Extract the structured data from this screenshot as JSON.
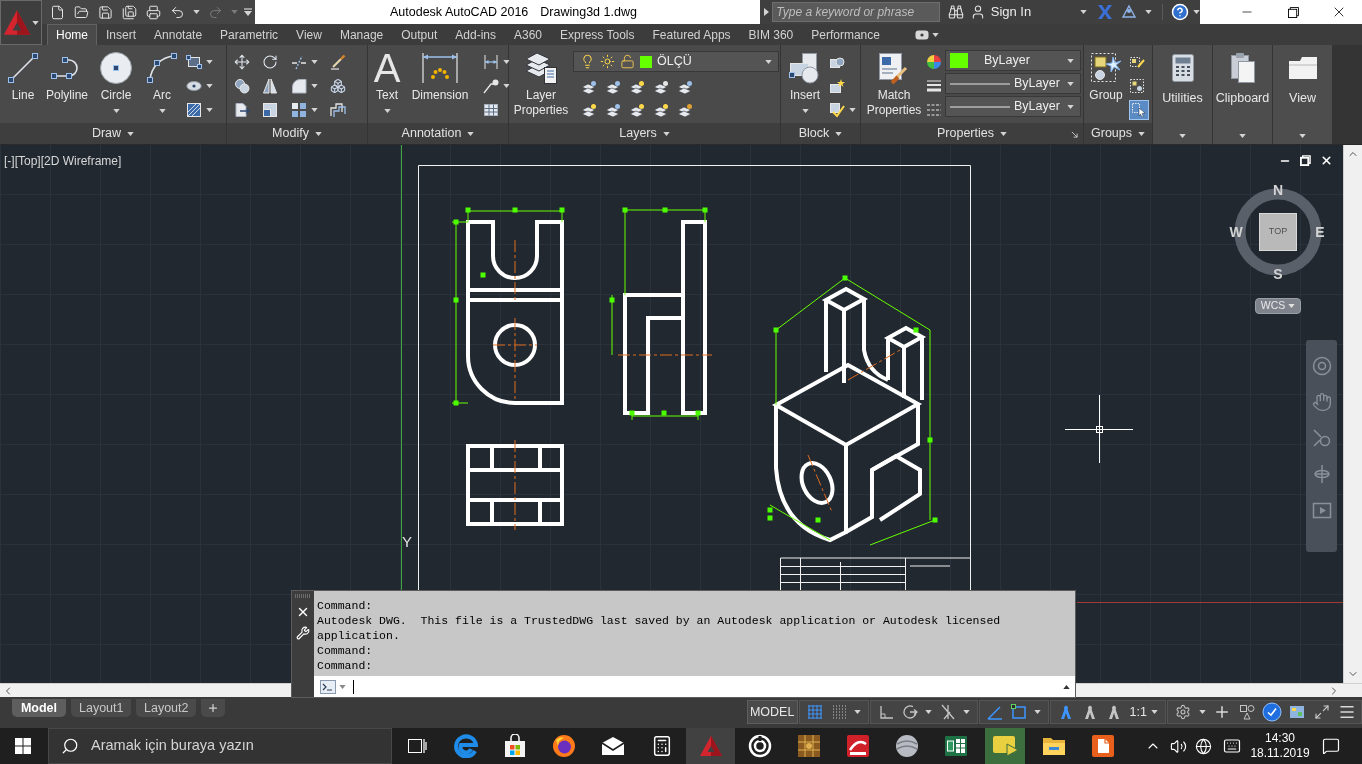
{
  "quick_access": [
    {
      "kind": "new",
      "disabled": false
    },
    {
      "kind": "open",
      "disabled": false
    },
    {
      "kind": "save",
      "disabled": false
    },
    {
      "kind": "save-as",
      "disabled": false
    },
    {
      "kind": "plot",
      "disabled": false
    },
    {
      "kind": "undo",
      "disabled": false
    },
    {
      "kind": "redo",
      "disabled": true
    }
  ],
  "title_bar": {
    "app_name": "Autodesk AutoCAD 2016",
    "document": "Drawing3d 1.dwg"
  },
  "search": {
    "placeholder": "Type a keyword or phrase"
  },
  "account": {
    "label": "Sign In"
  },
  "ribbon_tabs": [
    {
      "label": "Home",
      "selected": true
    },
    {
      "label": "Insert",
      "selected": false
    },
    {
      "label": "Annotate",
      "selected": false
    },
    {
      "label": "Parametric",
      "selected": false
    },
    {
      "label": "View",
      "selected": false
    },
    {
      "label": "Manage",
      "selected": false
    },
    {
      "label": "Output",
      "selected": false
    },
    {
      "label": "Add-ins",
      "selected": false
    },
    {
      "label": "A360",
      "selected": false
    },
    {
      "label": "Express Tools",
      "selected": false
    },
    {
      "label": "Featured Apps",
      "selected": false
    },
    {
      "label": "BIM 360",
      "selected": false
    },
    {
      "label": "Performance",
      "selected": false
    }
  ],
  "ribbon_panels": [
    {
      "kind": "draw",
      "title": "Draw",
      "tools": [
        {
          "kind": "line",
          "label": "Line",
          "dropdown": false
        },
        {
          "kind": "polyline",
          "label": "Polyline",
          "dropdown": false
        },
        {
          "kind": "circle",
          "label": "Circle",
          "dropdown": true
        },
        {
          "kind": "arc",
          "label": "Arc",
          "dropdown": true
        }
      ]
    },
    {
      "kind": "modify",
      "title": "Modify"
    },
    {
      "kind": "annotation",
      "title": "Annotation",
      "tools": [
        {
          "kind": "text",
          "label": "Text",
          "glyph": "A",
          "dropdown": true
        },
        {
          "kind": "dimension",
          "label": "Dimension",
          "dropdown": false
        }
      ]
    },
    {
      "kind": "layers",
      "title": "Layers",
      "tools": [
        {
          "kind": "layer-properties",
          "label": "Layer Properties",
          "dropdown": false
        }
      ],
      "layer_dropdown": {
        "value": "ÖLÇÜ",
        "color": "#66ff00",
        "on": true,
        "frozen": false,
        "locked": false
      }
    },
    {
      "kind": "block",
      "title": "Block",
      "tools": [
        {
          "kind": "insert",
          "label": "Insert",
          "dropdown": true
        }
      ]
    },
    {
      "kind": "properties",
      "title": "Properties",
      "tools": [
        {
          "kind": "match-properties",
          "label": "Match Properties",
          "dropdown": false
        }
      ],
      "color_dropdown": {
        "value": "ByLayer",
        "color": "#66ff00"
      },
      "lineweight_dropdown": {
        "value": "ByLayer"
      },
      "linetype_dropdown": {
        "value": "ByLayer"
      }
    },
    {
      "kind": "groups",
      "title": "Groups",
      "tools": [
        {
          "kind": "group",
          "label": "Group",
          "dropdown": false
        }
      ],
      "selection_toggle": {
        "on": true
      }
    }
  ],
  "collapsed_panels": [
    {
      "kind": "utilities",
      "label": "Utilities"
    },
    {
      "kind": "clipboard",
      "label": "Clipboard"
    },
    {
      "kind": "view",
      "label": "View"
    }
  ],
  "viewport": {
    "label": "[-][Top][2D Wireframe]",
    "axis_label": "Y",
    "viewcube": {
      "face": "TOP",
      "north": "N",
      "west": "W",
      "east": "E",
      "south": "S"
    },
    "ucs_menu": "WCS"
  },
  "command_line": {
    "history": [
      "Command:",
      "Autodesk DWG.  This file is a TrustedDWG last saved by an Autodesk application or Autodesk licensed application.",
      "Command:",
      "Command:"
    ]
  },
  "layout_tabs": [
    {
      "label": "Model",
      "selected": true
    },
    {
      "label": "Layout1",
      "selected": false
    },
    {
      "label": "Layout2",
      "selected": false
    }
  ],
  "status_bar": {
    "space": "MODEL",
    "toggles": [
      {
        "kind": "grid",
        "on": true,
        "dropdown": false
      },
      {
        "kind": "snap",
        "on": false,
        "dropdown": true
      },
      {
        "kind": "ortho",
        "on": false,
        "dropdown": false
      },
      {
        "kind": "polar",
        "on": false,
        "dropdown": true
      },
      {
        "kind": "isodraft",
        "on": false,
        "dropdown": true
      },
      {
        "kind": "dynamic-ucs",
        "on": true,
        "dropdown": false
      },
      {
        "kind": "object-snap",
        "on": true,
        "dropdown": true
      },
      {
        "kind": "annotation-visibility",
        "on": true,
        "dropdown": false
      },
      {
        "kind": "autoscale",
        "on": false,
        "dropdown": false
      },
      {
        "kind": "annotation-monitor",
        "on": false,
        "dropdown": false
      }
    ],
    "annotation_scale": "1:1",
    "controls": [
      {
        "kind": "workspace",
        "on": false,
        "dropdown": true
      },
      {
        "kind": "annotate-add",
        "on": false,
        "dropdown": false
      },
      {
        "kind": "isolate",
        "on": false,
        "dropdown": false
      },
      {
        "kind": "hardware-acceleration",
        "on": true,
        "dropdown": false
      },
      {
        "kind": "quick-properties",
        "on": false,
        "dropdown": false
      },
      {
        "kind": "clean-screen",
        "on": false,
        "dropdown": false
      },
      {
        "kind": "customization",
        "on": false,
        "dropdown": false
      }
    ]
  },
  "taskbar": {
    "search_placeholder": "Aramak için buraya yazın",
    "apps": [
      {
        "kind": "task-view",
        "active": false
      },
      {
        "kind": "browser",
        "active": false
      },
      {
        "kind": "store",
        "active": false
      },
      {
        "kind": "fox-browser",
        "active": false
      },
      {
        "kind": "mail",
        "active": false
      },
      {
        "kind": "calculator",
        "active": false
      },
      {
        "kind": "cad",
        "active": true
      },
      {
        "kind": "target",
        "active": false
      },
      {
        "kind": "tile-grid",
        "active": false
      },
      {
        "kind": "swoosh-tile",
        "active": false
      },
      {
        "kind": "sphere",
        "active": false
      },
      {
        "kind": "spreadsheet",
        "active": false
      },
      {
        "kind": "recorder",
        "active": false
      },
      {
        "kind": "folder",
        "active": false
      },
      {
        "kind": "document-app",
        "active": false
      }
    ],
    "time": "14:30",
    "date": "18.11.2019"
  }
}
